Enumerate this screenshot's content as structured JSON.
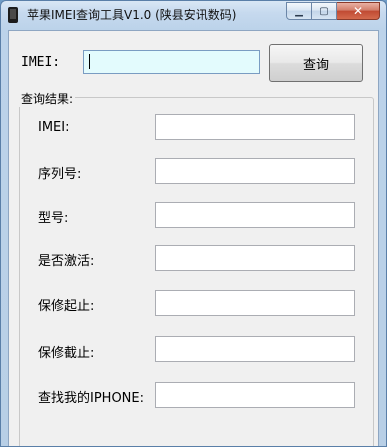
{
  "window": {
    "title": "苹果IMEI查询工具V1.0 (陕县安讯数码)",
    "icon": "phone-icon"
  },
  "caption": {
    "minimize": "▁",
    "maximize": "▢",
    "close": "✕"
  },
  "search": {
    "label": "IMEI:",
    "value": "",
    "button_label": "查询"
  },
  "results": {
    "group_title": "查询结果:",
    "fields": [
      {
        "label": "IMEI:",
        "value": ""
      },
      {
        "label": "序列号:",
        "value": ""
      },
      {
        "label": "型号:",
        "value": ""
      },
      {
        "label": "是否激活:",
        "value": ""
      },
      {
        "label": "保修起止:",
        "value": ""
      },
      {
        "label": "保修截止:",
        "value": ""
      },
      {
        "label": "查找我的IPHONE:",
        "value": ""
      }
    ]
  }
}
